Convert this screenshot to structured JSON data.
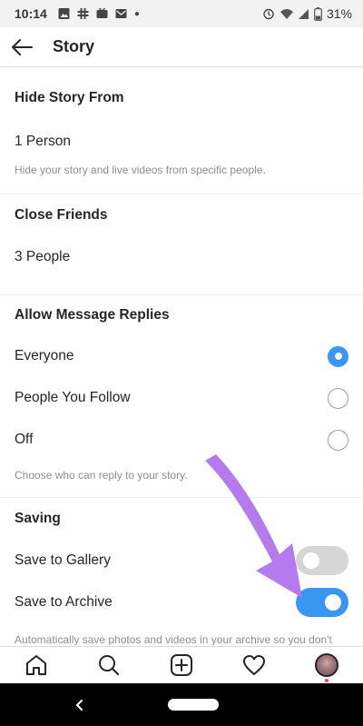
{
  "status_bar": {
    "time": "10:14",
    "battery": "31%"
  },
  "header": {
    "title": "Story",
    "back_icon": "arrow-left-icon"
  },
  "sections": {
    "hide_story": {
      "title": "Hide Story From",
      "value": "1 Person",
      "helper": "Hide your story and live videos from specific people."
    },
    "close_friends": {
      "title": "Close Friends",
      "value": "3 People"
    },
    "message_replies": {
      "title": "Allow Message Replies",
      "options": [
        {
          "label": "Everyone",
          "selected": true
        },
        {
          "label": "People You Follow",
          "selected": false
        },
        {
          "label": "Off",
          "selected": false
        }
      ],
      "helper": "Choose who can reply to your story."
    },
    "saving": {
      "title": "Saving",
      "save_to_gallery": {
        "label": "Save to Gallery",
        "enabled": false
      },
      "save_to_archive": {
        "label": "Save to Archive",
        "enabled": true
      },
      "helper": "Automatically save photos and videos in your archive so you don't have to save them to your phone. Only you can see them after they disappear from your story."
    }
  },
  "bottom_nav": [
    "home-icon",
    "search-icon",
    "add-post-icon",
    "heart-icon",
    "profile-avatar"
  ],
  "colors": {
    "accent": "#3897f0",
    "arrow": "#b57bee",
    "toggle_off": "#d6d6d6"
  }
}
